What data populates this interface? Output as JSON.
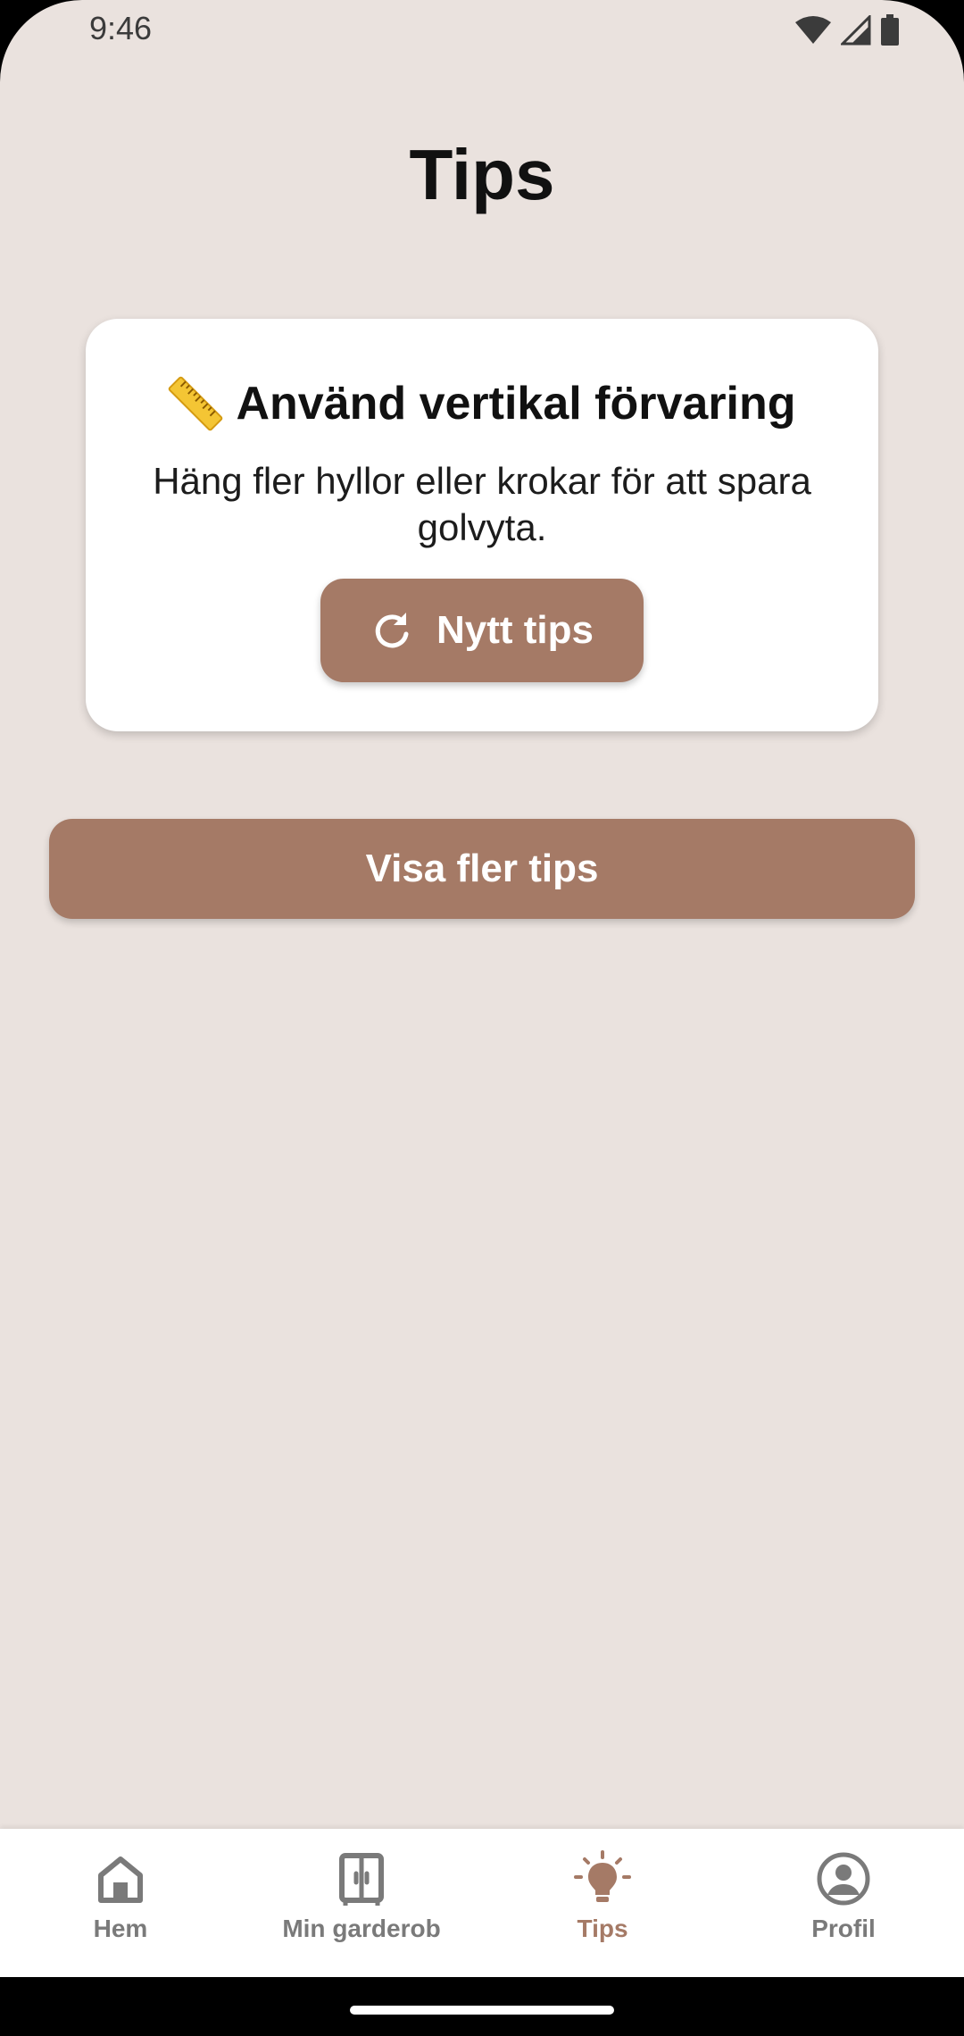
{
  "status_bar": {
    "time": "9:46",
    "icons": [
      "wifi-icon",
      "cellular-signal-icon",
      "battery-icon"
    ]
  },
  "page": {
    "title": "Tips"
  },
  "tip_card": {
    "emoji": "straight-ruler-icon",
    "title": "Använd vertikal förvaring",
    "body": "Häng fler hyllor eller krokar för att spara golvyta.",
    "new_tip_label": "Nytt tips",
    "new_tip_icon": "refresh-icon"
  },
  "actions": {
    "more_tips_label": "Visa fler tips"
  },
  "bottom_nav": {
    "items": [
      {
        "label": "Hem",
        "icon": "home-icon",
        "active": false
      },
      {
        "label": "Min garderob",
        "icon": "wardrobe-icon",
        "active": false
      },
      {
        "label": "Tips",
        "icon": "lightbulb-icon",
        "active": true
      },
      {
        "label": "Profil",
        "icon": "account-circle-icon",
        "active": false
      }
    ]
  },
  "colors": {
    "background": "#EAE2DE",
    "accent": "#A57A66",
    "card": "#FFFFFF",
    "nav_inactive": "#7A7A7A"
  }
}
